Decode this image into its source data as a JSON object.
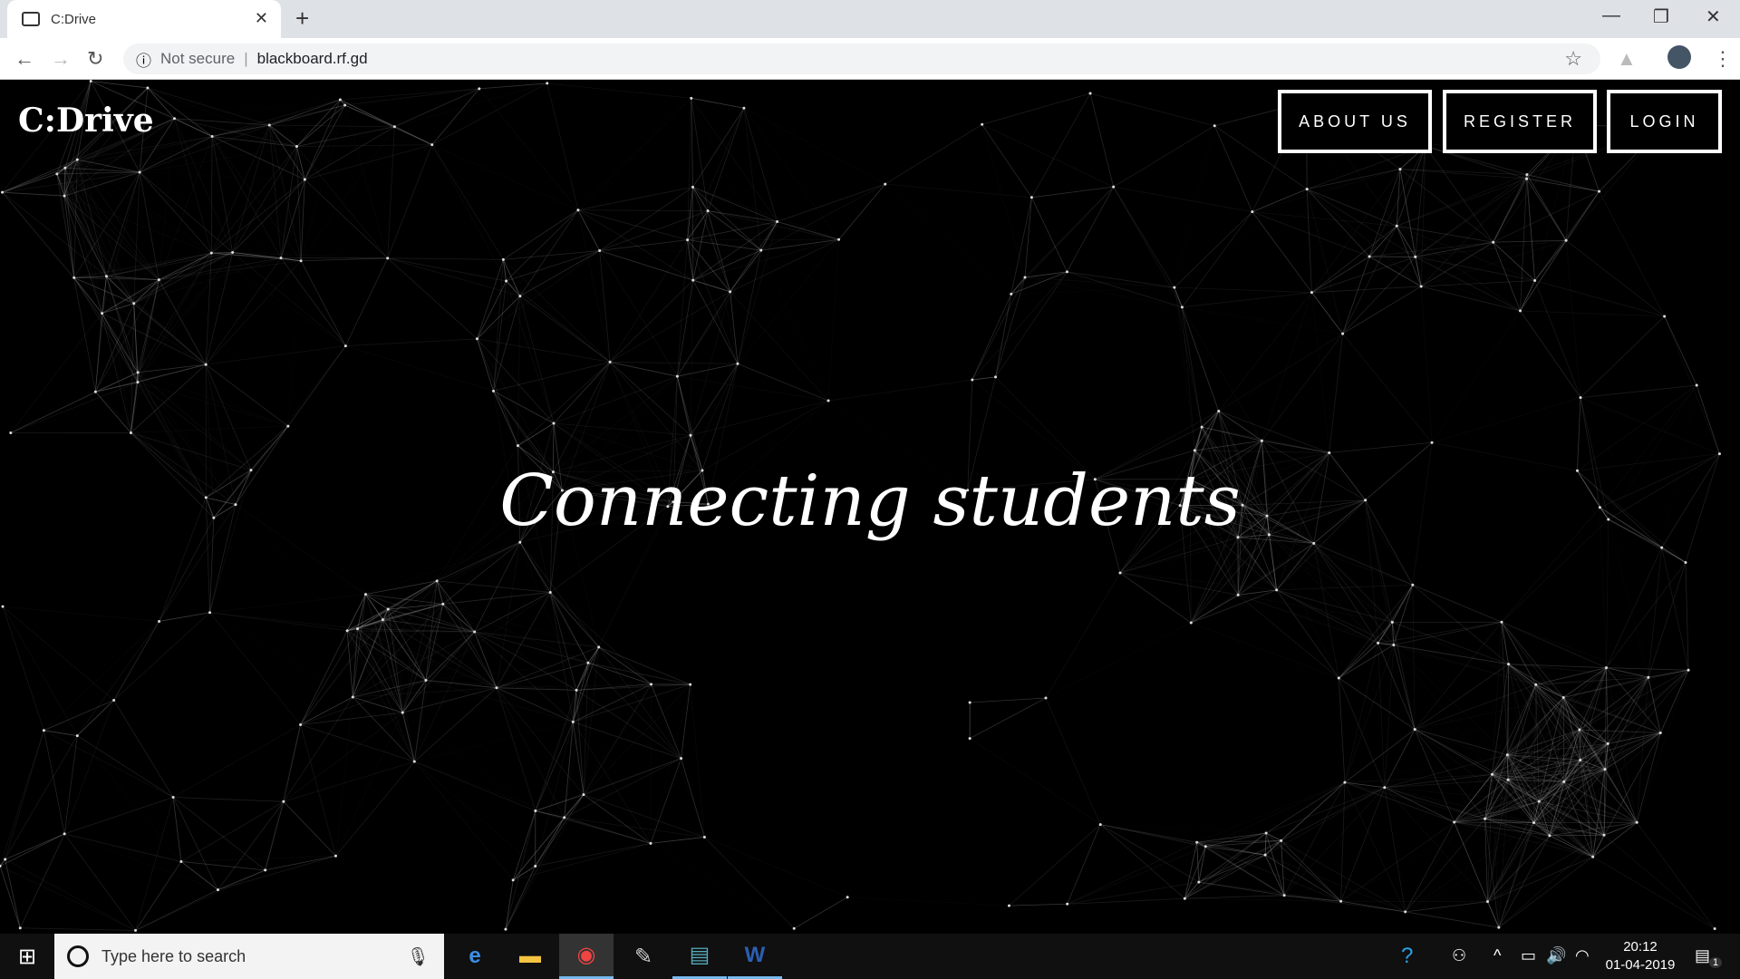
{
  "browser": {
    "tab_title": "C:Drive",
    "security": "Not secure",
    "url": "blackboard.rf.gd"
  },
  "site": {
    "logo": "C:Drive",
    "nav": [
      "ABOUT US",
      "REGISTER",
      "LOGIN"
    ],
    "headline": "Connecting students"
  },
  "taskbar": {
    "search_placeholder": "Type here to search",
    "time": "20:12",
    "date": "01-04-2019",
    "notifications": "1",
    "apps": [
      "edge-icon",
      "file-explorer-icon",
      "chrome-icon",
      "paint-icon",
      "python-icon",
      "word-icon"
    ]
  },
  "colors": {
    "background": "#000000",
    "text": "#ffffff",
    "network_lines": "#9a9a9a"
  }
}
